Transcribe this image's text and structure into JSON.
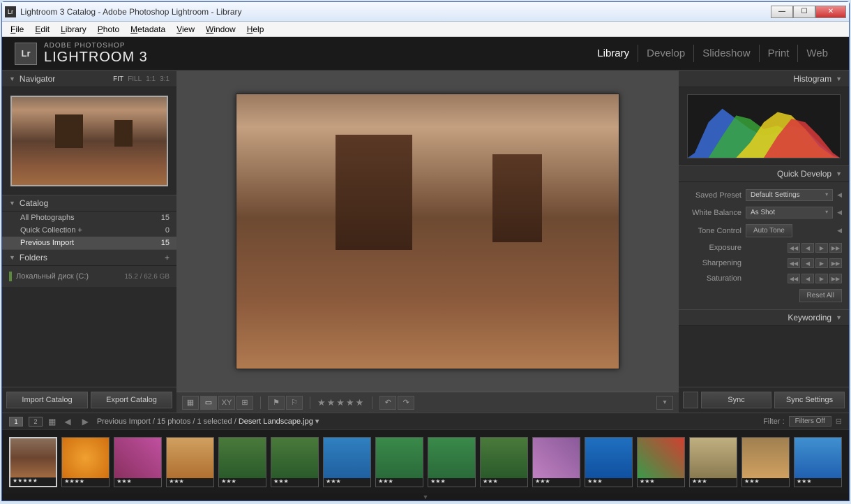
{
  "window": {
    "title": "Lightroom 3 Catalog - Adobe Photoshop Lightroom - Library",
    "icon": "Lr"
  },
  "menu": [
    "File",
    "Edit",
    "Library",
    "Photo",
    "Metadata",
    "View",
    "Window",
    "Help"
  ],
  "identity": {
    "super": "ADOBE PHOTOSHOP",
    "title": "LIGHTROOM 3"
  },
  "modules": [
    {
      "label": "Library",
      "active": true
    },
    {
      "label": "Develop",
      "active": false
    },
    {
      "label": "Slideshow",
      "active": false
    },
    {
      "label": "Print",
      "active": false
    },
    {
      "label": "Web",
      "active": false
    }
  ],
  "navigator": {
    "title": "Navigator",
    "modes": [
      {
        "l": "FIT",
        "a": true
      },
      {
        "l": "FILL",
        "a": false
      },
      {
        "l": "1:1",
        "a": false
      },
      {
        "l": "3:1",
        "a": false
      }
    ]
  },
  "catalog": {
    "title": "Catalog",
    "rows": [
      {
        "label": "All Photographs",
        "count": "15",
        "sel": false
      },
      {
        "label": "Quick Collection  +",
        "count": "0",
        "sel": false
      },
      {
        "label": "Previous Import",
        "count": "15",
        "sel": true
      }
    ]
  },
  "folders": {
    "title": "Folders",
    "drive": {
      "name": "Локальный диск (C:)",
      "size": "15.2 / 62.6 GB"
    }
  },
  "left_buttons": {
    "import": "Import Catalog",
    "export": "Export Catalog"
  },
  "histogram": {
    "title": "Histogram"
  },
  "quick_develop": {
    "title": "Quick Develop",
    "preset_label": "Saved Preset",
    "preset_value": "Default Settings",
    "wb_label": "White Balance",
    "wb_value": "As Shot",
    "tone_label": "Tone Control",
    "autotone": "Auto Tone",
    "exposure_label": "Exposure",
    "sharpening_label": "Sharpening",
    "saturation_label": "Saturation",
    "reset": "Reset All"
  },
  "keywording": {
    "title": "Keywording"
  },
  "sync": {
    "sync": "Sync",
    "settings": "Sync Settings"
  },
  "filmstrip_bar": {
    "path": "Previous Import / 15 photos / 1 selected /",
    "file": "Desert Landscape.jpg",
    "filter_label": "Filter :",
    "filter_value": "Filters Off"
  },
  "thumbs": [
    {
      "c": "t1",
      "s": "★★★★★",
      "sel": true
    },
    {
      "c": "t2",
      "s": "★★★★"
    },
    {
      "c": "t3",
      "s": "★★★"
    },
    {
      "c": "t4",
      "s": "★★★"
    },
    {
      "c": "t5",
      "s": "★★★"
    },
    {
      "c": "t6",
      "s": "★★★"
    },
    {
      "c": "t7",
      "s": "★★★"
    },
    {
      "c": "t8",
      "s": "★★★"
    },
    {
      "c": "t9",
      "s": "★★★"
    },
    {
      "c": "t10",
      "s": "★★★"
    },
    {
      "c": "t11",
      "s": "★★★"
    },
    {
      "c": "t12",
      "s": "★★★"
    },
    {
      "c": "t13",
      "s": "★★★"
    },
    {
      "c": "t14",
      "s": "★★★"
    },
    {
      "c": "t15",
      "s": "★★★"
    },
    {
      "c": "t16",
      "s": "★★★"
    }
  ]
}
